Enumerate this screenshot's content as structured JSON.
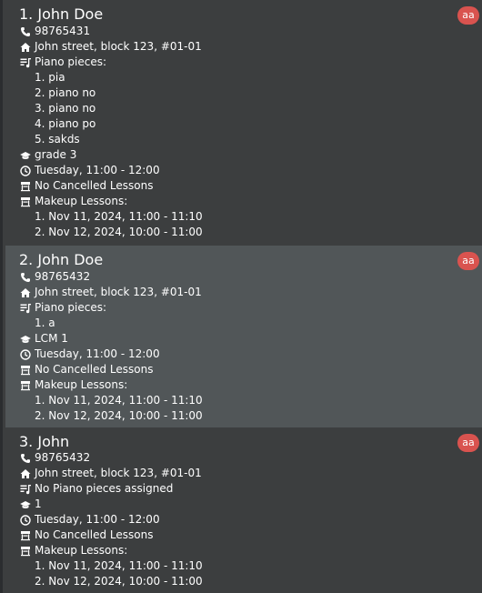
{
  "students": [
    {
      "title": "1. John Doe",
      "tag": "aa",
      "phone": "98765431",
      "address": "John street, block 123, #01-01",
      "pieces_label": "Piano pieces:",
      "pieces": [
        "1. pia",
        "2. piano  no",
        "3. piano no",
        "4. piano po",
        "5. sakds"
      ],
      "grade": "grade 3",
      "schedule": "Tuesday, 11:00 - 12:00",
      "cancelled": "No Cancelled Lessons",
      "makeup_label": "Makeup Lessons:",
      "makeup": [
        "1. Nov 11, 2024, 11:00 - 11:10",
        "2. Nov 12, 2024, 10:00 - 11:00"
      ]
    },
    {
      "title": "2. John Doe",
      "tag": "aa",
      "phone": "98765432",
      "address": "John street, block 123, #01-01",
      "pieces_label": "Piano pieces:",
      "pieces": [
        "1. a"
      ],
      "grade": "LCM 1",
      "schedule": "Tuesday, 11:00 - 12:00",
      "cancelled": "No Cancelled Lessons",
      "makeup_label": "Makeup Lessons:",
      "makeup": [
        "1. Nov 11, 2024, 11:00 - 11:10",
        "2. Nov 12, 2024, 10:00 - 11:00"
      ]
    },
    {
      "title": "3. John",
      "tag": "aa",
      "phone": "98765432",
      "address": "John street, block 123, #01-01",
      "pieces_label": "No Piano pieces assigned",
      "grade": "1",
      "schedule": "Tuesday, 11:00 - 12:00",
      "cancelled": "No Cancelled Lessons",
      "makeup_label": "Makeup Lessons:",
      "makeup": [
        "1. Nov 11, 2024, 11:00 - 11:10",
        "2. Nov 12, 2024, 10:00 - 11:00"
      ]
    }
  ],
  "icons": {
    "phone": "phone-icon",
    "address": "home-icon",
    "pieces": "music-list-icon",
    "grade": "graduation-cap-icon",
    "schedule": "clock-icon",
    "cancelled": "calendar-cancel-icon",
    "makeup": "calendar-makeup-icon"
  },
  "colors": {
    "background": "#3c3e3f",
    "selected_row": "#515658",
    "tag": "#d9534f",
    "text": "#ffffff"
  }
}
